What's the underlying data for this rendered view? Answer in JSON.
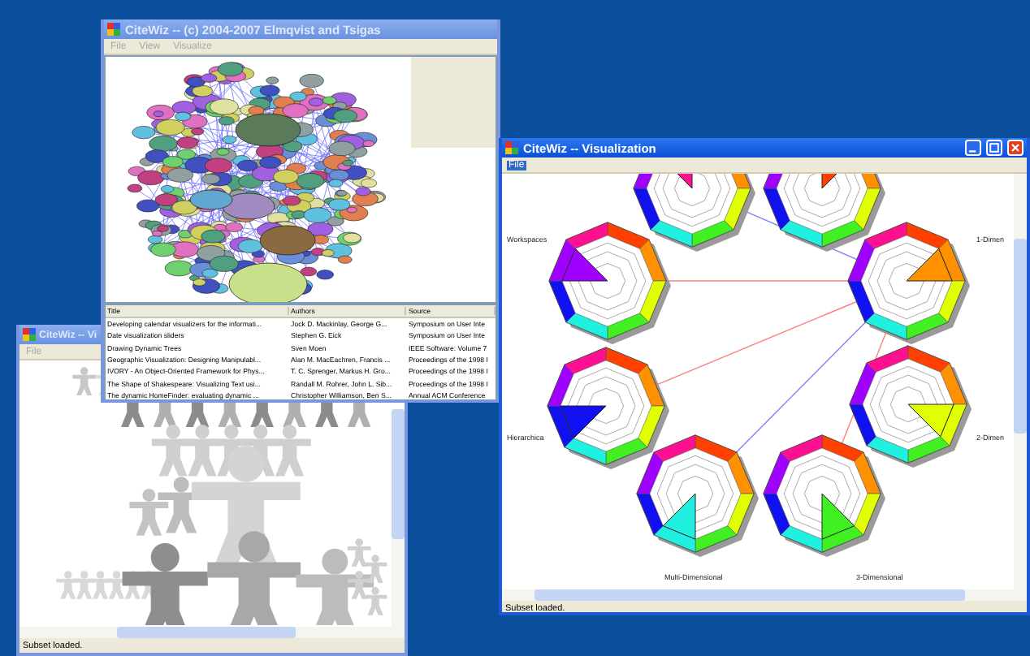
{
  "windows": [
    {
      "kind": "tree",
      "active": false,
      "title": "CiteWiz -- Vi",
      "menu": [
        {
          "label": "File",
          "selected": false
        }
      ],
      "status": "Subset loaded."
    },
    {
      "kind": "graph",
      "active": false,
      "title": "CiteWiz -- (c) 2004-2007 Elmqvist and Tsigas",
      "menu": [
        {
          "label": "File",
          "selected": false
        },
        {
          "label": "View",
          "selected": false
        },
        {
          "label": "Visualize",
          "selected": false
        }
      ],
      "table": {
        "columns": [
          "Title",
          "Authors",
          "Source"
        ],
        "rows": [
          [
            "Developing calendar visualizers for the informati...",
            "Jock D. Mackinlay, George G...",
            "Symposium on User Inte"
          ],
          [
            "Date visualization sliders",
            "Stephen G. Eick",
            "Symposium on User Inte"
          ],
          [
            "Drawing Dynamic Trees",
            "Sven Moen",
            "IEEE Software: Volume 7"
          ],
          [
            "Geographic Visualization: Designing Manipulabl...",
            "Alan M. MacEachren, Francis ...",
            "Proceedings of the 1998 I"
          ],
          [
            "IVORY - An Object-Oriented Framework for Phys...",
            "T. C. Sprenger, Markus H. Gro...",
            "Proceedings of the 1998 I"
          ],
          [
            "The Shape of Shakespeare: Visualizing Text usi...",
            "Randall M. Rohrer, John L. Sib...",
            "Proceedings of the 1998 I"
          ],
          [
            "The dynamic HomeFinder: evaluating dynamic ...",
            "Christopher Williamson, Ben S...",
            "Annual ACM Conference"
          ]
        ]
      }
    },
    {
      "kind": "glyphs",
      "active": true,
      "title": "CiteWiz -- Visualization",
      "menu": [
        {
          "label": "File",
          "selected": true
        }
      ],
      "labels": [
        "Workspaces",
        "1-Dimen",
        "Hierarchica",
        "2-Dimen",
        "Multi-Dimensional",
        "3-Dimensional"
      ],
      "status": "Subset loaded."
    }
  ]
}
